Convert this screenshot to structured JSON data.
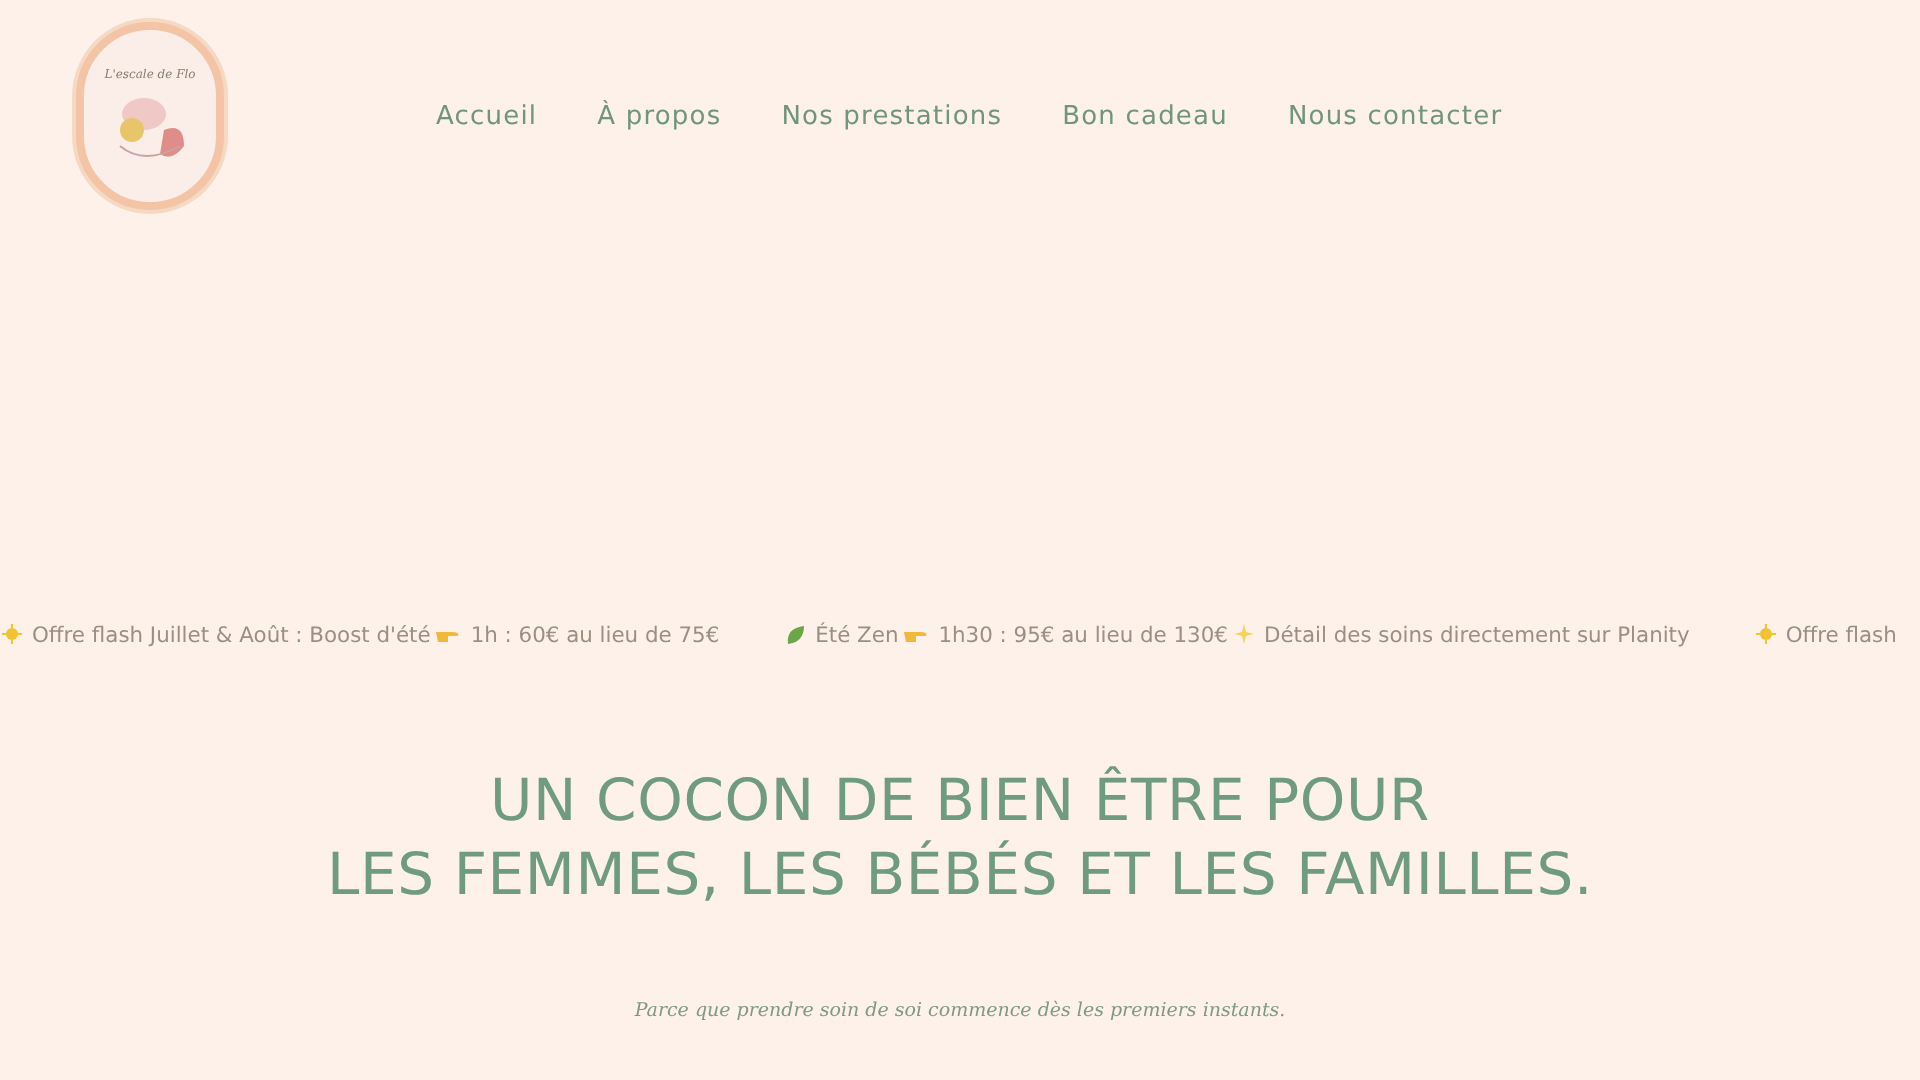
{
  "header": {
    "logo_text": "L'escale de Flo",
    "nav": [
      {
        "label": "Accueil"
      },
      {
        "label": "À propos"
      },
      {
        "label": "Nos prestations"
      },
      {
        "label": "Bon cadeau"
      },
      {
        "label": "Nous contacter"
      }
    ]
  },
  "ticker": [
    {
      "kind": "sun",
      "text": "Offre flash Juillet & Août : Boost d'été"
    },
    {
      "kind": "hand",
      "text": "1h : 60€ au lieu de 75€"
    },
    {
      "kind": "gap"
    },
    {
      "kind": "leaf",
      "text": "Été Zen"
    },
    {
      "kind": "hand",
      "text": "1h30 : 95€ au lieu de 130€"
    },
    {
      "kind": "sparkle",
      "text": "Détail des soins directement sur Planity"
    },
    {
      "kind": "gap"
    },
    {
      "kind": "sun",
      "text": "Offre flash"
    }
  ],
  "hero": {
    "title_lines": [
      "UN COCON DE BIEN ÊTRE POUR",
      "LES FEMMES, LES BÉBÉS ET LES FAMILLES."
    ],
    "tagline": "Parce que prendre soin de soi commence dès les premiers instants."
  }
}
